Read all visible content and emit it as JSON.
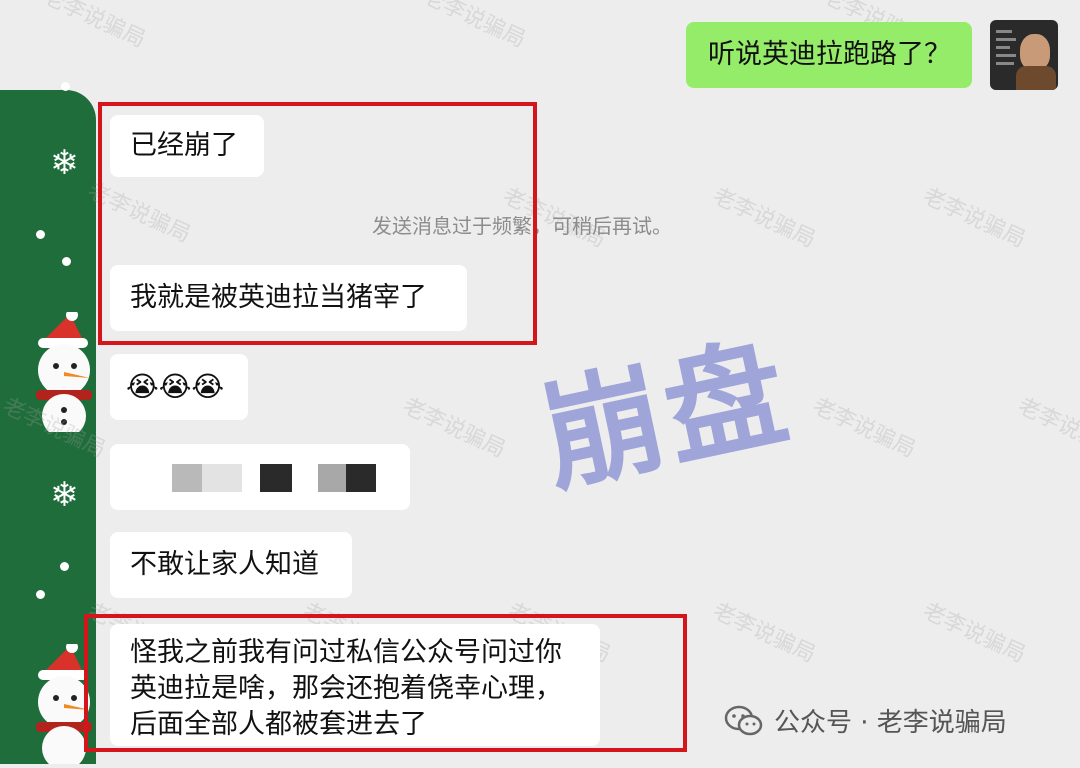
{
  "chat": {
    "sent_message": "听说英迪拉跑路了？",
    "received": [
      "已经崩了",
      "我就是被英迪拉当猪宰了",
      "😭😭😭",
      "不敢让家人知道"
    ],
    "long_message_lines": [
      "怪我之前我有问过私信公众号问过你",
      "英迪拉是啥，那会还抱着侥幸心理，",
      "后面全部人都被套进去了"
    ],
    "system_notice": "发送消息过于频繁，可稍后再试。"
  },
  "overlay": {
    "stamp_text": "崩盘",
    "watermark": "老李说骗局"
  },
  "footer": {
    "label": "公众号 · 老李说骗局"
  },
  "colors": {
    "highlight_box": "#d4151b",
    "sent_bubble": "#95ec69",
    "strip_green": "#1f6d3a"
  }
}
